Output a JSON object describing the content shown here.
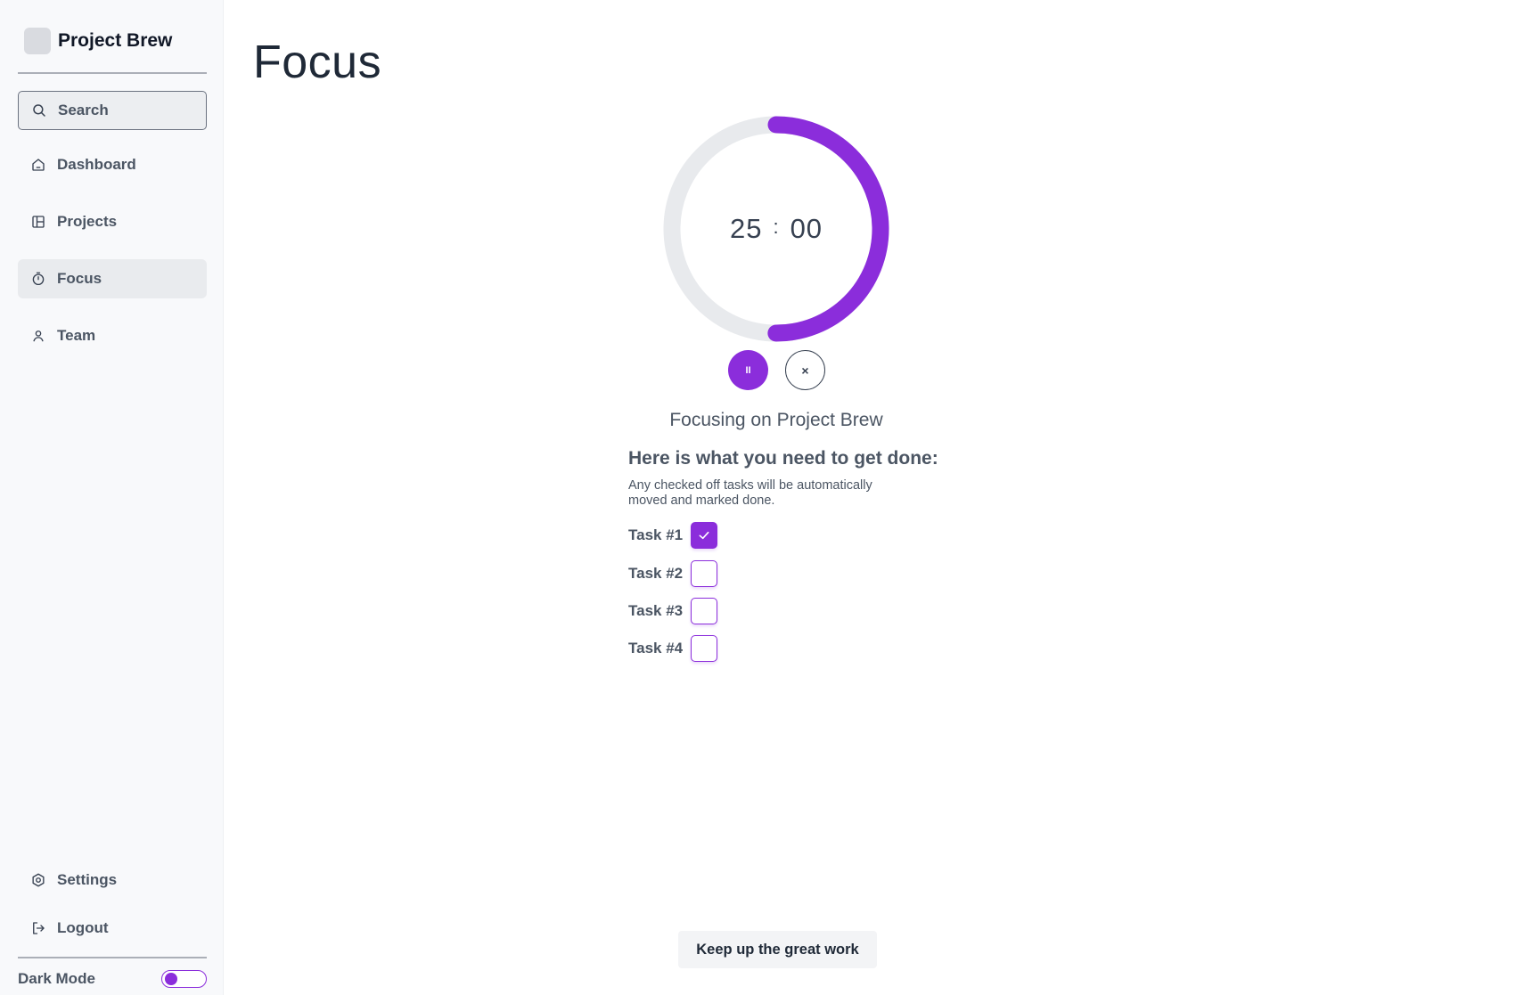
{
  "app": {
    "name": "Project Brew"
  },
  "sidebar": {
    "search": {
      "label": "Search",
      "icon": "search-icon"
    },
    "items": [
      {
        "label": "Dashboard",
        "icon": "home-icon",
        "active": false
      },
      {
        "label": "Projects",
        "icon": "layout-icon",
        "active": false
      },
      {
        "label": "Focus",
        "icon": "timer-icon",
        "active": true
      },
      {
        "label": "Team",
        "icon": "user-icon",
        "active": false
      }
    ],
    "bottom_items": [
      {
        "label": "Settings",
        "icon": "gear-icon"
      },
      {
        "label": "Logout",
        "icon": "logout-icon"
      }
    ],
    "dark_mode": {
      "label": "Dark Mode",
      "enabled": false
    }
  },
  "main": {
    "title": "Focus",
    "timer": {
      "minutes": "25",
      "separator": ":",
      "seconds": "00",
      "progress": 0.5,
      "accent_color": "#8b2ddb",
      "track_color": "#e8eaed"
    },
    "controls": {
      "pause_symbol": "II",
      "stop_symbol": "×"
    },
    "focusing_text": "Focusing on Project Brew",
    "todo_title": "Here is what you need to get done:",
    "todo_note": "Any checked off tasks will be automatically moved and marked done.",
    "tasks": [
      {
        "label": "Task #1",
        "checked": true
      },
      {
        "label": "Task #2",
        "checked": false
      },
      {
        "label": "Task #3",
        "checked": false
      },
      {
        "label": "Task #4",
        "checked": false
      }
    ],
    "cheer": "Keep up the great work"
  }
}
